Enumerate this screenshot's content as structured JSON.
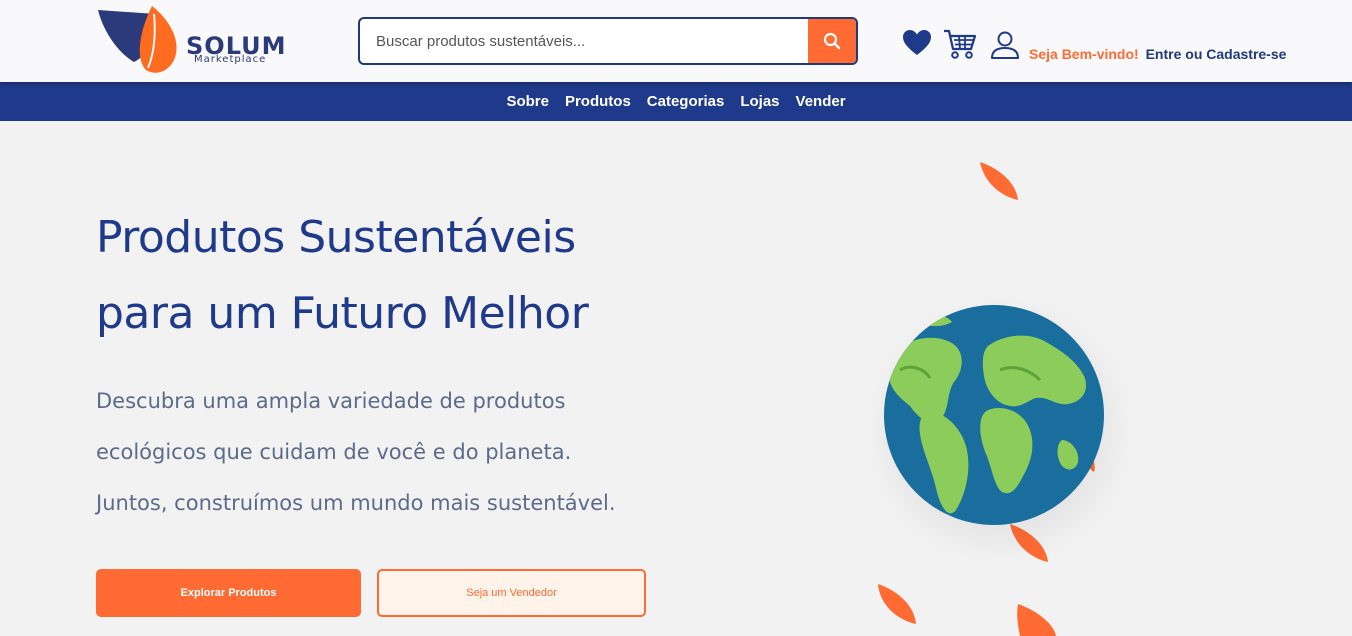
{
  "brand": {
    "name": "SOLUM",
    "tagline": "Marketplace",
    "colors": {
      "primary": "#1f3a8a",
      "accent": "#ff6b33",
      "background": "#f2f2f2"
    }
  },
  "search": {
    "placeholder": "Buscar produtos sustentáveis...",
    "icon": "search-icon"
  },
  "header": {
    "icons": [
      "heart-icon",
      "cart-icon",
      "user-icon"
    ],
    "welcome": "Seja Bem-vindo!",
    "login_link": "Entre ou Cadastre-se"
  },
  "nav": {
    "items": [
      "Sobre",
      "Produtos",
      "Categorias",
      "Lojas",
      "Vender"
    ]
  },
  "hero": {
    "title_line1": "Produtos Sustentáveis",
    "title_line2": "para um Futuro Melhor",
    "desc_line1": "Descubra uma ampla variedade de produtos",
    "desc_line2": "ecológicos que cuidam de você e do planeta.",
    "desc_line3": "Juntos, construímos um mundo mais sustentável.",
    "primary_button": "Explorar Produtos",
    "secondary_button": "Seja um Vendedor"
  }
}
